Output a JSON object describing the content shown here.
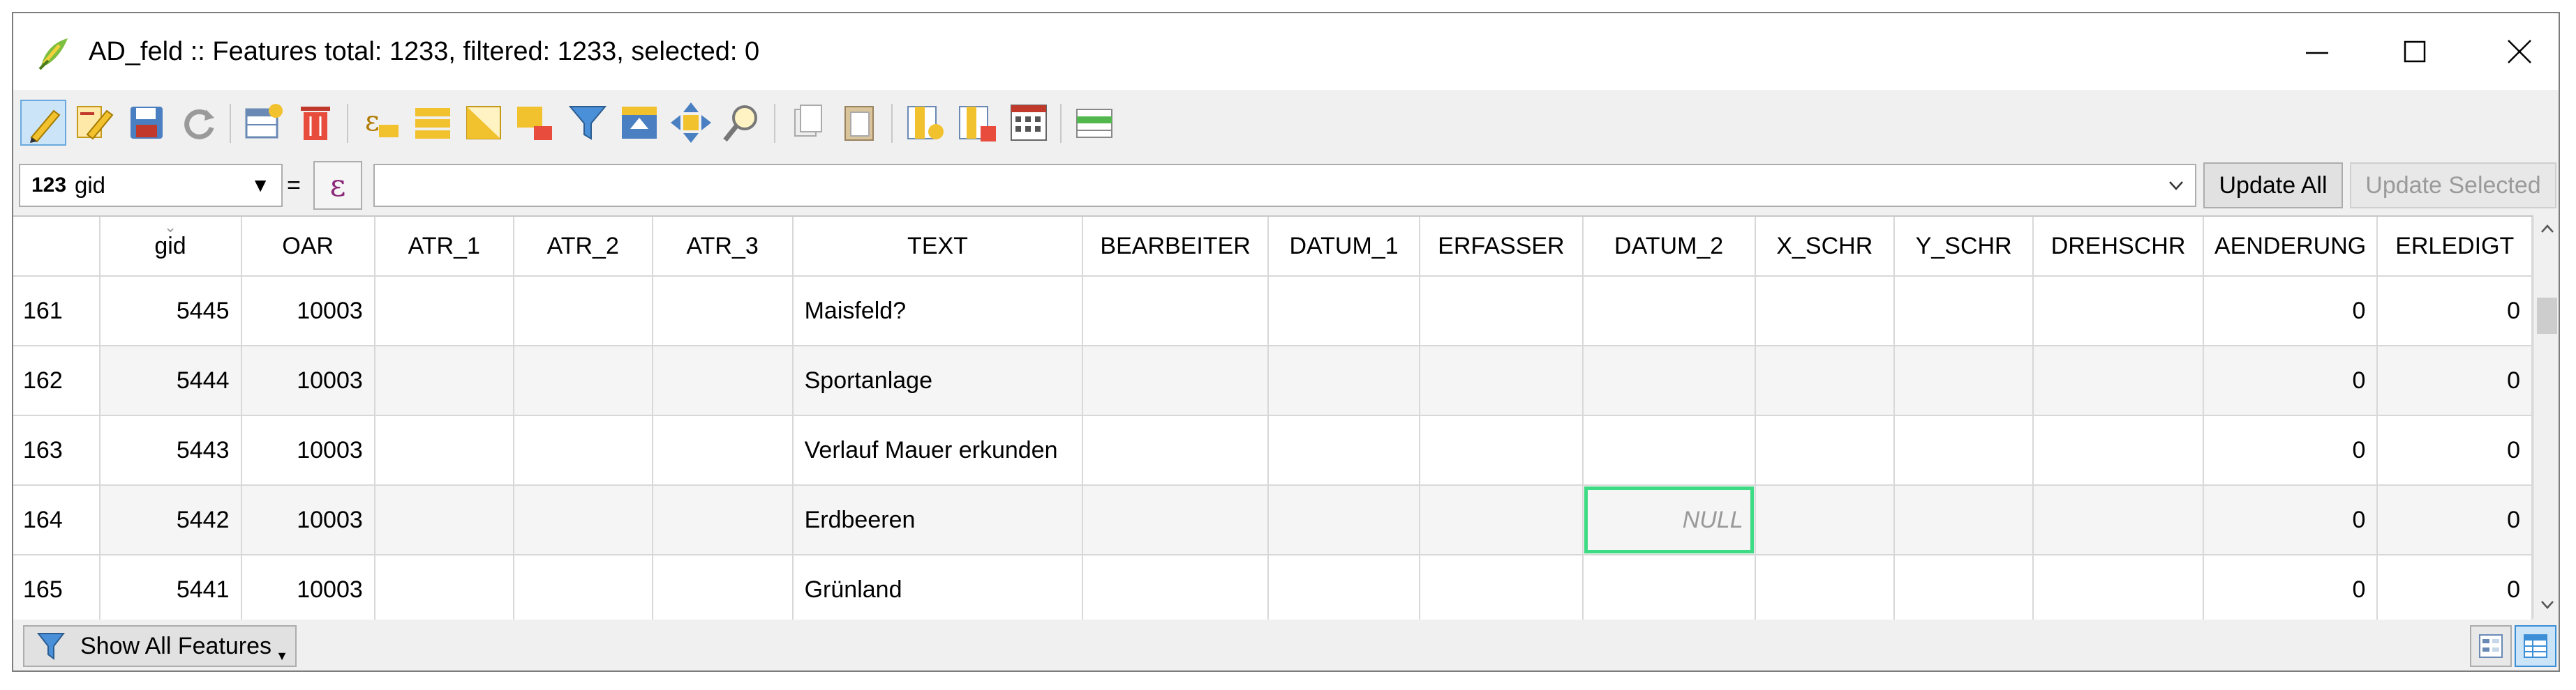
{
  "window": {
    "title": "AD_feld :: Features total: 1233, filtered: 1233, selected: 0",
    "controls": [
      "minimize-icon",
      "maximize-icon",
      "close-icon"
    ]
  },
  "toolbar": {
    "buttons": [
      "toggle-editing-icon",
      "multi-edit-icon",
      "save-edits-icon",
      "reload-icon",
      "add-feature-icon",
      "delete-feature-icon",
      "select-by-expression-icon",
      "select-all-icon",
      "invert-selection-icon",
      "deselect-all-icon",
      "filter-select-icon",
      "move-selection-top-icon",
      "pan-to-selected-icon",
      "zoom-to-selected-icon",
      "copy-icon",
      "paste-icon",
      "new-field-icon",
      "delete-field-icon",
      "field-calculator-icon",
      "conditional-formatting-icon"
    ]
  },
  "exprbar": {
    "field_type": "123",
    "field_name": "gid",
    "equals": "=",
    "expression_symbol": "ε",
    "expression_value": "",
    "update_all": "Update All",
    "update_selected": "Update Selected"
  },
  "table": {
    "columns": [
      "gid",
      "OAR",
      "ATR_1",
      "ATR_2",
      "ATR_3",
      "TEXT",
      "BEARBEITER",
      "DATUM_1",
      "ERFASSER",
      "DATUM_2",
      "X_SCHR",
      "Y_SCHR",
      "DREHSCHR",
      "AENDERUNG",
      "ERLEDIGT"
    ],
    "rows": [
      {
        "row": "161",
        "gid": "5445",
        "OAR": "10003",
        "TEXT": "Maisfeld?",
        "AENDERUNG": "0",
        "ERLEDIGT": "0"
      },
      {
        "row": "162",
        "gid": "5444",
        "OAR": "10003",
        "TEXT": "Sportanlage",
        "AENDERUNG": "0",
        "ERLEDIGT": "0"
      },
      {
        "row": "163",
        "gid": "5443",
        "OAR": "10003",
        "TEXT": "Verlauf Mauer erkunden",
        "AENDERUNG": "0",
        "ERLEDIGT": "0"
      },
      {
        "row": "164",
        "gid": "5442",
        "OAR": "10003",
        "TEXT": "Erdbeeren",
        "DATUM_2": "NULL",
        "AENDERUNG": "0",
        "ERLEDIGT": "0"
      },
      {
        "row": "165",
        "gid": "5441",
        "OAR": "10003",
        "TEXT": "Grünland",
        "AENDERUNG": "0",
        "ERLEDIGT": "0"
      }
    ],
    "current_cell": {
      "row": "164",
      "column": "DATUM_2"
    }
  },
  "bottombar": {
    "show_all": "Show All Features",
    "view_form": "form-view-icon",
    "view_table": "table-view-icon"
  },
  "colors": {
    "selection_outline": "#3ddc84",
    "active_tool": "#cce4f7"
  }
}
